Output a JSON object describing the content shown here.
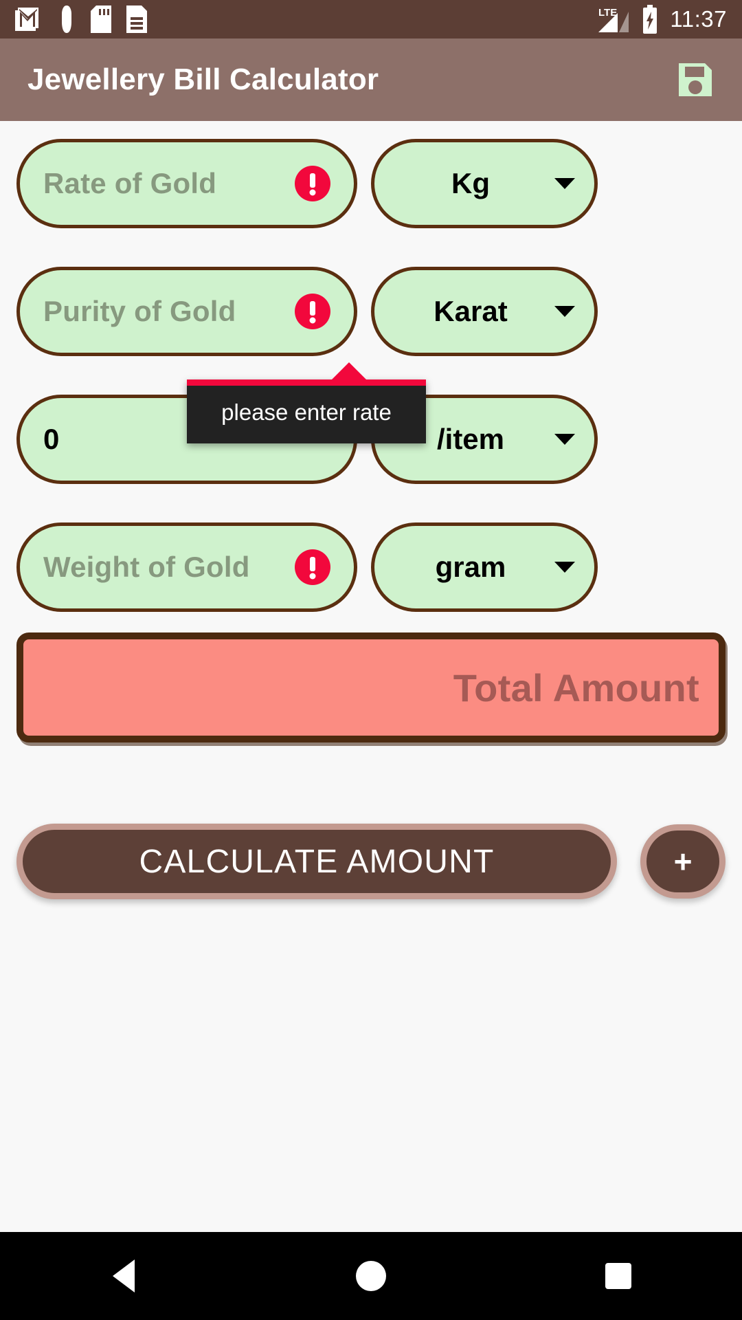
{
  "status_bar": {
    "time": "11:37",
    "network_label": "LTE",
    "icons": [
      "gmail-icon",
      "usb-debug-icon",
      "sd-card-icon",
      "document-icon",
      "lte-signal-icon",
      "battery-charging-icon"
    ],
    "background_color": "#5C3E35"
  },
  "app_bar": {
    "title": "Jewellery Bill Calculator",
    "save_icon": "save-floppy-icon",
    "background_color": "#8D7069",
    "icon_color": "#CFF2CD"
  },
  "theme": {
    "field_fill": "#CFF2CD",
    "field_border": "#5B2F10",
    "placeholder_color": "#87997F",
    "error_color": "#F2083C",
    "total_fill": "#FB8C82",
    "total_border": "#4C2A10",
    "button_fill": "#5D4037",
    "button_ring": "#C39A90",
    "page_background": "#F8F8F8"
  },
  "form": {
    "rate": {
      "placeholder": "Rate of Gold",
      "value": "",
      "has_error": true,
      "error_icon": "error-exclamation-icon",
      "unit": "Kg",
      "unit_caret": "chevron-down-icon"
    },
    "purity": {
      "placeholder": "Purity of Gold",
      "value": "",
      "has_error": true,
      "error_icon": "error-exclamation-icon",
      "unit": "Karat",
      "unit_caret": "chevron-down-icon"
    },
    "making": {
      "placeholder": "",
      "value": "0",
      "has_error": false,
      "unit": "/item",
      "unit_caret": "chevron-down-icon"
    },
    "weight": {
      "placeholder": "Weight of Gold",
      "value": "",
      "has_error": true,
      "error_icon": "error-exclamation-icon",
      "unit": "gram",
      "unit_caret": "chevron-down-icon"
    }
  },
  "tooltip": {
    "message": "please enter rate",
    "accent_color": "#F2083C",
    "background_color": "#222222"
  },
  "total": {
    "label": "Total Amount",
    "value": ""
  },
  "actions": {
    "calculate_label": "CALCULATE AMOUNT",
    "add_label": "+"
  },
  "nav_bar": {
    "back": "back-triangle-icon",
    "home": "home-circle-icon",
    "recents": "recents-square-icon"
  }
}
